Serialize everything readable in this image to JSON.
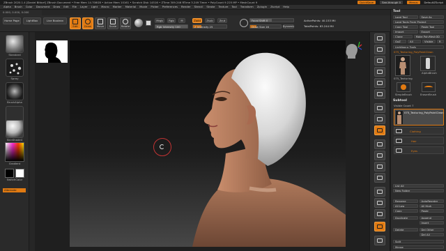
{
  "titlebar": {
    "title": "ZBrush 2020.1.4 [Daniel Bittorf]   ZBrush Document   • Free Mem 14.708GB • Active Mem 10161 • Scratch Disk 14516 • ZTime 309.246 RTime 3.249 Timer • PolyCount 9.225 MP • MeshCount 9",
    "quicksave": "QuickSave",
    "seethrough": "See-through 0",
    "menus": "Menus",
    "script": "DefaultZScript"
  },
  "menubar": [
    "Alpha",
    "Brush",
    "Color",
    "Document",
    "Draw",
    "Edit",
    "File",
    "Layer",
    "Light",
    "Macro",
    "Marker",
    "Material",
    "Movie",
    "Picker",
    "Preferences",
    "Render",
    "Stencil",
    "Stroke",
    "Texture",
    "Tool",
    "Transform",
    "Zplugin",
    "Zscript",
    "Help"
  ],
  "leftinfo": "0.000, 0.000, 0.000",
  "toolbar": {
    "homepage": "Home Page",
    "lightbox": "LightBox",
    "liveboolean": "Live Boolean",
    "edit": "Edit",
    "draw": "Draw",
    "move": "Move",
    "scale": "Scale",
    "rotate": "Rotate",
    "mrgb": "Mrgb",
    "rgb": "Rgb",
    "m": "M",
    "zadd": "Zadd",
    "zsub": "Zsub",
    "zcut": "Zcut",
    "rgb_intensity": "Rgb Intensity 100",
    "z_intensity": "Z Intensity 25",
    "focal_shift": "Focal Shift 0",
    "draw_size": "Draw Size 16",
    "dynamic": "Dynamic",
    "active_points": "ActivePoints: 40.153 Mil",
    "total_points": "TotalPoints: 63.244 Mil"
  },
  "lefttray": {
    "items": [
      {
        "label": "Standard"
      },
      {
        "label": "Spray"
      },
      {
        "label": "BrushAlpha"
      },
      {
        "label": "Texture Off"
      },
      {
        "label": "SkinShade4"
      },
      {
        "label": "Gradient"
      },
      {
        "label": "SwitchColor"
      },
      {
        "label": "Alternate"
      }
    ]
  },
  "shelf": {
    "buttons": [
      "BPR",
      "SPix 3",
      "Scroll",
      "Zoom",
      "Actual",
      "AAHalf",
      "Persp",
      "Floor",
      "Local",
      "Frame",
      "Move",
      "ZoomD",
      "Rotate",
      "Line Fill",
      "Transp",
      "Dynamic",
      "Solo",
      "Xpose"
    ]
  },
  "toolpanel": {
    "header": "Tool",
    "row1": [
      "Load Tool",
      "Save As"
    ],
    "row2": [
      "Load Tools From Project"
    ],
    "row3": [
      "Copy Tool",
      "Paste Tool"
    ],
    "row4": [
      "Import",
      "Export"
    ],
    "row5": [
      "Clone",
      "Make PolyMesh3D"
    ],
    "row6": [
      "GoZ",
      "All",
      "Visible",
      "R"
    ],
    "lightbox_tools": "Lightbox ▸ Tools",
    "current_tool": "075_Texturing_PolyPaintClean",
    "tool_thumbs": [
      "075_Texturing",
      "AlphaBrush",
      "SimpleBrush",
      "EraserBrush"
    ],
    "subtool_header": "Subtool",
    "visible_count": "Visible Count 7",
    "subtools": [
      "075_Texturing_PolyPaintClean",
      "Clothing",
      "Hair",
      "Eyes"
    ],
    "list_all": "List All",
    "new_folder": "New Folder",
    "rename": "Rename",
    "autoreorder": "AutoReorder",
    "all_low": "All Low",
    "all_high": "All High",
    "copy": "Copy",
    "paste": "Paste",
    "duplicate": "Duplicate",
    "append": "Append",
    "insert": "Insert",
    "delete": "Delete",
    "del_other": "Del Other",
    "del_all": "Del All",
    "split": "Split",
    "merge": "Merge"
  },
  "colors": {
    "accent": "#e07a12",
    "panel": "#2c2c2c",
    "background": "#1f1f1f"
  }
}
